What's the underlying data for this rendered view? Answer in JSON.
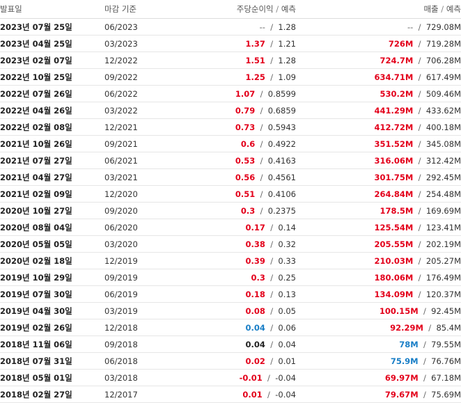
{
  "colors": {
    "beat": "#e3001b",
    "miss": "#1a7fc7",
    "inline": "#222222",
    "na": "#666666"
  },
  "header": {
    "date": "발표일",
    "period": "마감 기준",
    "eps": "주당순이익",
    "eps_forecast": "예측",
    "revenue": "매출",
    "revenue_forecast": "예측",
    "slash": "/"
  },
  "rows": [
    {
      "date": "2023년 07월 25일",
      "period": "06/2023",
      "eps": "--",
      "eps_est": "1.28",
      "eps_tone": "na",
      "rev": "--",
      "rev_est": "729.08M",
      "rev_tone": "na"
    },
    {
      "date": "2023년 04월 25일",
      "period": "03/2023",
      "eps": "1.37",
      "eps_est": "1.21",
      "eps_tone": "beat",
      "rev": "726M",
      "rev_est": "719.28M",
      "rev_tone": "beat"
    },
    {
      "date": "2023년 02월 07일",
      "period": "12/2022",
      "eps": "1.51",
      "eps_est": "1.28",
      "eps_tone": "beat",
      "rev": "724.7M",
      "rev_est": "706.28M",
      "rev_tone": "beat"
    },
    {
      "date": "2022년 10월 25일",
      "period": "09/2022",
      "eps": "1.25",
      "eps_est": "1.09",
      "eps_tone": "beat",
      "rev": "634.71M",
      "rev_est": "617.49M",
      "rev_tone": "beat"
    },
    {
      "date": "2022년 07월 26일",
      "period": "06/2022",
      "eps": "1.07",
      "eps_est": "0.8599",
      "eps_tone": "beat",
      "rev": "530.2M",
      "rev_est": "509.46M",
      "rev_tone": "beat"
    },
    {
      "date": "2022년 04월 26일",
      "period": "03/2022",
      "eps": "0.79",
      "eps_est": "0.6859",
      "eps_tone": "beat",
      "rev": "441.29M",
      "rev_est": "433.62M",
      "rev_tone": "beat"
    },
    {
      "date": "2022년 02월 08일",
      "period": "12/2021",
      "eps": "0.73",
      "eps_est": "0.5943",
      "eps_tone": "beat",
      "rev": "412.72M",
      "rev_est": "400.18M",
      "rev_tone": "beat"
    },
    {
      "date": "2021년 10월 26일",
      "period": "09/2021",
      "eps": "0.6",
      "eps_est": "0.4922",
      "eps_tone": "beat",
      "rev": "351.52M",
      "rev_est": "345.08M",
      "rev_tone": "beat"
    },
    {
      "date": "2021년 07월 27일",
      "period": "06/2021",
      "eps": "0.53",
      "eps_est": "0.4163",
      "eps_tone": "beat",
      "rev": "316.06M",
      "rev_est": "312.42M",
      "rev_tone": "beat"
    },
    {
      "date": "2021년 04월 27일",
      "period": "03/2021",
      "eps": "0.56",
      "eps_est": "0.4561",
      "eps_tone": "beat",
      "rev": "301.75M",
      "rev_est": "292.45M",
      "rev_tone": "beat"
    },
    {
      "date": "2021년 02월 09일",
      "period": "12/2020",
      "eps": "0.51",
      "eps_est": "0.4106",
      "eps_tone": "beat",
      "rev": "264.84M",
      "rev_est": "254.48M",
      "rev_tone": "beat"
    },
    {
      "date": "2020년 10월 27일",
      "period": "09/2020",
      "eps": "0.3",
      "eps_est": "0.2375",
      "eps_tone": "beat",
      "rev": "178.5M",
      "rev_est": "169.69M",
      "rev_tone": "beat"
    },
    {
      "date": "2020년 08월 04일",
      "period": "06/2020",
      "eps": "0.17",
      "eps_est": "0.14",
      "eps_tone": "beat",
      "rev": "125.54M",
      "rev_est": "123.41M",
      "rev_tone": "beat"
    },
    {
      "date": "2020년 05월 05일",
      "period": "03/2020",
      "eps": "0.38",
      "eps_est": "0.32",
      "eps_tone": "beat",
      "rev": "205.55M",
      "rev_est": "202.19M",
      "rev_tone": "beat"
    },
    {
      "date": "2020년 02월 18일",
      "period": "12/2019",
      "eps": "0.39",
      "eps_est": "0.33",
      "eps_tone": "beat",
      "rev": "210.03M",
      "rev_est": "205.27M",
      "rev_tone": "beat"
    },
    {
      "date": "2019년 10월 29일",
      "period": "09/2019",
      "eps": "0.3",
      "eps_est": "0.25",
      "eps_tone": "beat",
      "rev": "180.06M",
      "rev_est": "176.49M",
      "rev_tone": "beat"
    },
    {
      "date": "2019년 07월 30일",
      "period": "06/2019",
      "eps": "0.18",
      "eps_est": "0.13",
      "eps_tone": "beat",
      "rev": "134.09M",
      "rev_est": "120.37M",
      "rev_tone": "beat"
    },
    {
      "date": "2019년 04월 30일",
      "period": "03/2019",
      "eps": "0.08",
      "eps_est": "0.05",
      "eps_tone": "beat",
      "rev": "100.15M",
      "rev_est": "92.45M",
      "rev_tone": "beat"
    },
    {
      "date": "2019년 02월 26일",
      "period": "12/2018",
      "eps": "0.04",
      "eps_est": "0.06",
      "eps_tone": "miss",
      "rev": "92.29M",
      "rev_est": "85.4M",
      "rev_tone": "beat"
    },
    {
      "date": "2018년 11월 06일",
      "period": "09/2018",
      "eps": "0.04",
      "eps_est": "0.04",
      "eps_tone": "inline",
      "rev": "78M",
      "rev_est": "79.55M",
      "rev_tone": "miss"
    },
    {
      "date": "2018년 07월 31일",
      "period": "06/2018",
      "eps": "0.02",
      "eps_est": "0.01",
      "eps_tone": "beat",
      "rev": "75.9M",
      "rev_est": "76.76M",
      "rev_tone": "miss"
    },
    {
      "date": "2018년 05월 01일",
      "period": "03/2018",
      "eps": "-0.01",
      "eps_est": "-0.04",
      "eps_tone": "beat",
      "rev": "69.97M",
      "rev_est": "67.18M",
      "rev_tone": "beat"
    },
    {
      "date": "2018년 02월 27일",
      "period": "12/2017",
      "eps": "0.01",
      "eps_est": "-0.04",
      "eps_tone": "beat",
      "rev": "79.67M",
      "rev_est": "75.69M",
      "rev_tone": "beat"
    }
  ]
}
